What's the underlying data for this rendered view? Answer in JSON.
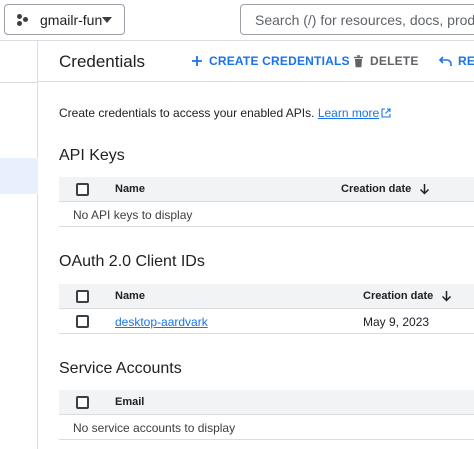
{
  "topbar": {
    "project_name": "gmailr-fun",
    "search_placeholder": "Search (/) for resources, docs, products, and more"
  },
  "header": {
    "title": "Credentials",
    "actions": {
      "create": "CREATE CREDENTIALS",
      "delete": "DELETE",
      "restore": "RES"
    }
  },
  "intro": {
    "text": "Create credentials to access your enabled APIs.",
    "link": "Learn more"
  },
  "api_keys": {
    "title": "API Keys",
    "columns": {
      "name": "Name",
      "creation_date": "Creation date"
    },
    "empty": "No API keys to display"
  },
  "oauth": {
    "title": "OAuth 2.0 Client IDs",
    "columns": {
      "name": "Name",
      "creation_date": "Creation date"
    },
    "rows": [
      {
        "name": "desktop-aardvark",
        "creation_date": "May 9, 2023"
      }
    ]
  },
  "service_accounts": {
    "title": "Service Accounts",
    "columns": {
      "email": "Email"
    },
    "empty": "No service accounts to display"
  },
  "colors": {
    "accent": "#1a73e8",
    "text": "#202124",
    "muted": "#5f6368",
    "header_bg": "#f1f3f4",
    "border": "#dadce0"
  }
}
